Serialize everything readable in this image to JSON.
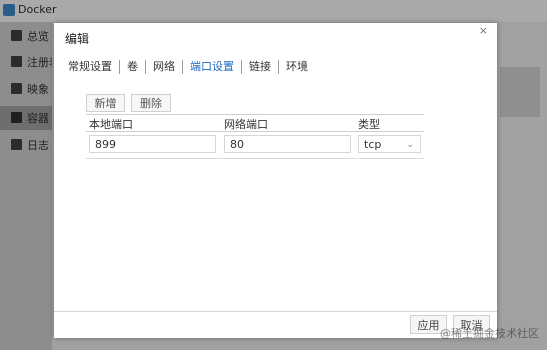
{
  "app": {
    "title": "Docker",
    "sidebar": {
      "items": [
        {
          "label": "总览",
          "icon": "monitor-icon"
        },
        {
          "label": "注册表",
          "icon": "registry-icon"
        },
        {
          "label": "映象",
          "icon": "image-icon"
        },
        {
          "label": "容器",
          "icon": "container-icon",
          "active": true
        },
        {
          "label": "日志",
          "icon": "log-icon"
        }
      ]
    }
  },
  "dialog": {
    "title": "编辑",
    "close_label": "×",
    "tabs": [
      {
        "label": "常规设置",
        "active": false
      },
      {
        "label": "卷",
        "active": false
      },
      {
        "label": "网络",
        "active": false
      },
      {
        "label": "端口设置",
        "active": true
      },
      {
        "label": "链接",
        "active": false
      },
      {
        "label": "环境",
        "active": false
      }
    ],
    "toolbar": {
      "add_label": "新增",
      "delete_label": "删除"
    },
    "table": {
      "columns": [
        "本地端口",
        "网络端口",
        "类型"
      ],
      "rows": [
        {
          "local_port": "899",
          "container_port": "80",
          "type": "tcp"
        }
      ]
    },
    "footer": {
      "apply_label": "应用",
      "cancel_label": "取消"
    }
  },
  "watermark": "@稀土掘金技术社区",
  "colors": {
    "accent": "#1d6ac0",
    "overlay": "#9a9a9a",
    "dialog_bg": "#ffffff"
  }
}
